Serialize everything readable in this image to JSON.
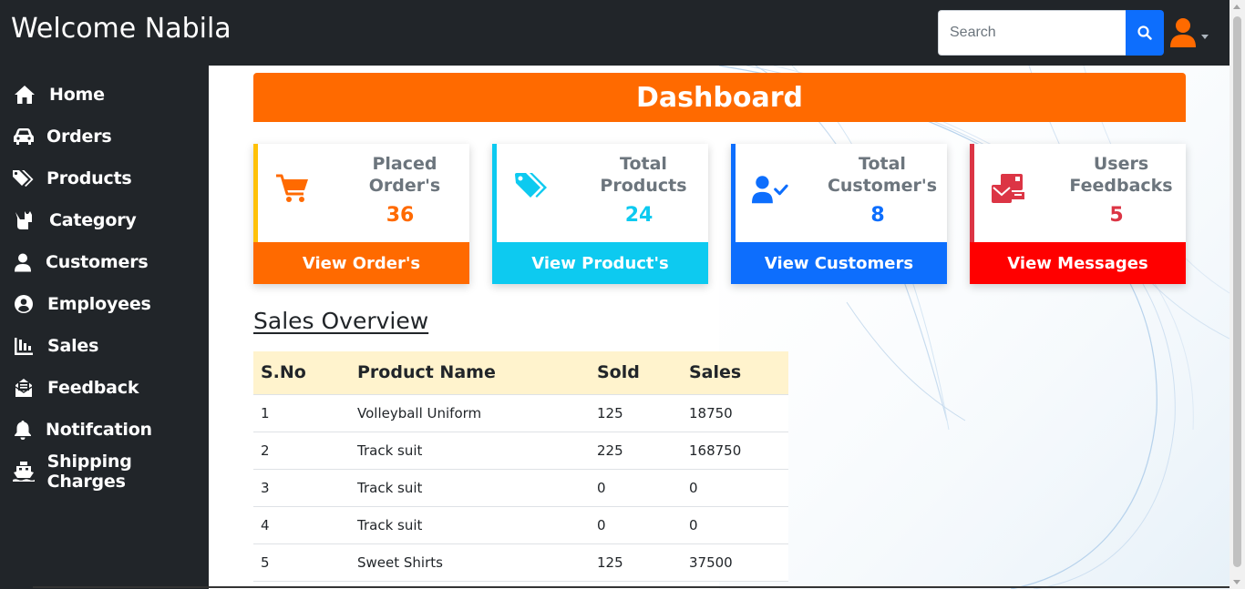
{
  "header": {
    "brand": "Welcome Nabila",
    "search_placeholder": "Search"
  },
  "sidebar": {
    "items": [
      {
        "label": "Home",
        "icon": "home-icon"
      },
      {
        "label": "Orders",
        "icon": "car-icon"
      },
      {
        "label": "Products",
        "icon": "tags-icon"
      },
      {
        "label": "Category",
        "icon": "cat-icon"
      },
      {
        "label": "Customers",
        "icon": "user-icon"
      },
      {
        "label": "Employees",
        "icon": "user-circle-icon"
      },
      {
        "label": "Sales",
        "icon": "chart-icon"
      },
      {
        "label": "Feedback",
        "icon": "envelope-open-icon"
      },
      {
        "label": "Notifcation",
        "icon": "bell-icon"
      },
      {
        "label": "Shipping Charges",
        "icon": "ship-icon"
      }
    ]
  },
  "dashboard": {
    "title": "Dashboard",
    "cards": [
      {
        "title_line1": "Placed",
        "title_line2": "Order's",
        "value": "36",
        "action": "View Order's",
        "accent": "#ffc107",
        "value_color": "#ff6a00",
        "footer_color": "#ff6a00",
        "icon": "cart-icon"
      },
      {
        "title_line1": "Total",
        "title_line2": "Products",
        "value": "24",
        "action": "View Product's",
        "accent": "#0dcaf0",
        "value_color": "#0dcaf0",
        "footer_color": "#0dcaf0",
        "icon": "tags-icon"
      },
      {
        "title_line1": "Total",
        "title_line2": "Customer's",
        "value": "8",
        "action": "View Customers",
        "accent": "#0d6efd",
        "value_color": "#0d6efd",
        "footer_color": "#0d6efd",
        "icon": "user-check-icon"
      },
      {
        "title_line1": "Users",
        "title_line2": "Feedbacks",
        "value": "5",
        "action": "View Messages",
        "accent": "#dc3545",
        "value_color": "#dc3545",
        "footer_color": "#ff0000",
        "icon": "mail-bulk-icon"
      }
    ]
  },
  "sales": {
    "title": "Sales Overview",
    "headers": [
      "S.No",
      "Product Name",
      "Sold",
      "Sales"
    ],
    "rows": [
      [
        "1",
        "Volleyball Uniform",
        "125",
        "18750"
      ],
      [
        "2",
        "Track suit",
        "225",
        "168750"
      ],
      [
        "3",
        "Track suit",
        "0",
        "0"
      ],
      [
        "4",
        "Track suit",
        "0",
        "0"
      ],
      [
        "5",
        "Sweet Shirts",
        "125",
        "37500"
      ]
    ]
  }
}
